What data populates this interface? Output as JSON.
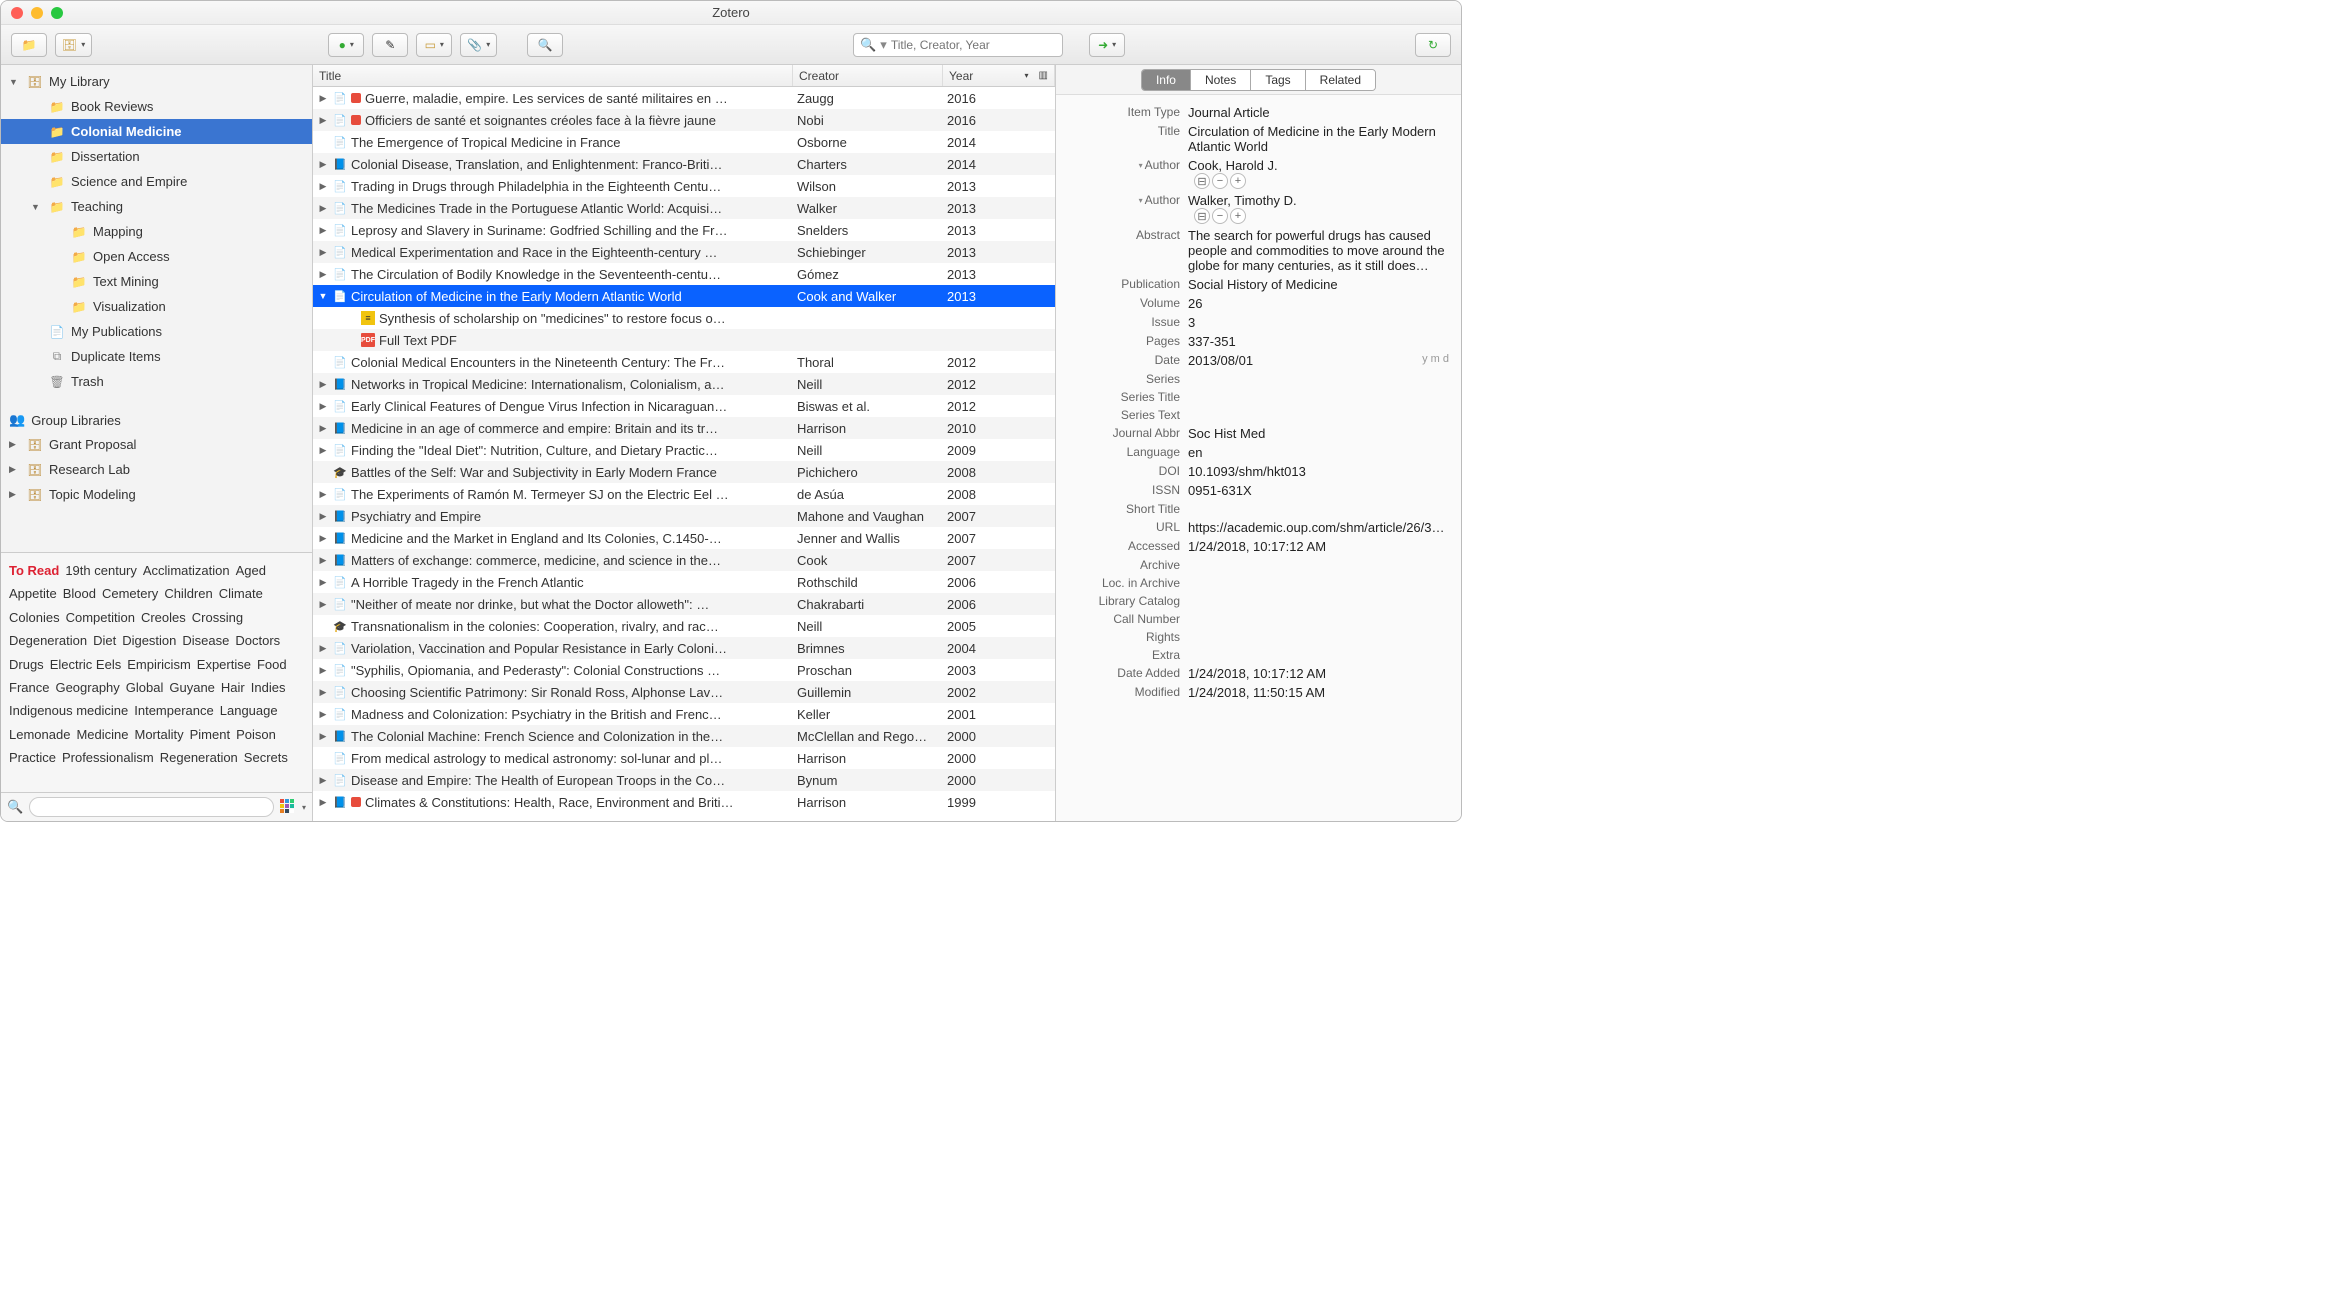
{
  "window_title": "Zotero",
  "toolbar": {
    "search_placeholder": "Title, Creator, Year"
  },
  "sidebar": {
    "my_library": "My Library",
    "items": [
      {
        "label": "Book Reviews",
        "depth": 1
      },
      {
        "label": "Colonial Medicine",
        "depth": 1,
        "selected": true
      },
      {
        "label": "Dissertation",
        "depth": 1
      },
      {
        "label": "Science and Empire",
        "depth": 1
      },
      {
        "label": "Teaching",
        "depth": 1,
        "expandable": true,
        "expanded": true
      },
      {
        "label": "Mapping",
        "depth": 2
      },
      {
        "label": "Open Access",
        "depth": 2
      },
      {
        "label": "Text Mining",
        "depth": 2
      },
      {
        "label": "Visualization",
        "depth": 2
      }
    ],
    "special": [
      {
        "label": "My Publications",
        "icon": "pubs"
      },
      {
        "label": "Duplicate Items",
        "icon": "dup"
      },
      {
        "label": "Trash",
        "icon": "trash"
      }
    ],
    "group_header": "Group Libraries",
    "groups": [
      {
        "label": "Grant Proposal"
      },
      {
        "label": "Research Lab"
      },
      {
        "label": "Topic Modeling"
      }
    ]
  },
  "tags": [
    "To Read",
    "19th century",
    "Acclimatization",
    "Aged",
    "Appetite",
    "Blood",
    "Cemetery",
    "Children",
    "Climate",
    "Colonies",
    "Competition",
    "Creoles",
    "Crossing",
    "Degeneration",
    "Diet",
    "Digestion",
    "Disease",
    "Doctors",
    "Drugs",
    "Electric Eels",
    "Empiricism",
    "Expertise",
    "Food",
    "France",
    "Geography",
    "Global",
    "Guyane",
    "Hair",
    "Indies",
    "Indigenous medicine",
    "Intemperance",
    "Language",
    "Lemonade",
    "Medicine",
    "Mortality",
    "Piment",
    "Poison",
    "Practice",
    "Professionalism",
    "Regeneration",
    "Secrets"
  ],
  "tag_hot": "To Read",
  "columns": {
    "title": "Title",
    "creator": "Creator",
    "year": "Year"
  },
  "items": [
    {
      "tw": "▶",
      "type": "page",
      "tag": "red",
      "title": "Guerre, maladie, empire. Les services de santé militaires en …",
      "creator": "Zaugg",
      "year": "2016"
    },
    {
      "tw": "▶",
      "type": "page",
      "tag": "red",
      "title": "Officiers de santé et soignantes créoles face à la fièvre jaune",
      "creator": "Nobi",
      "year": "2016"
    },
    {
      "tw": "",
      "type": "page",
      "title": "The Emergence of Tropical Medicine in France",
      "creator": "Osborne",
      "year": "2014"
    },
    {
      "tw": "▶",
      "type": "book",
      "title": "Colonial Disease, Translation, and Enlightenment: Franco-Briti…",
      "creator": "Charters",
      "year": "2014"
    },
    {
      "tw": "▶",
      "type": "page",
      "title": "Trading in Drugs through Philadelphia in the Eighteenth Centu…",
      "creator": "Wilson",
      "year": "2013"
    },
    {
      "tw": "▶",
      "type": "page",
      "title": "The Medicines Trade in the Portuguese Atlantic World: Acquisi…",
      "creator": "Walker",
      "year": "2013"
    },
    {
      "tw": "▶",
      "type": "page",
      "title": "Leprosy and Slavery in Suriname: Godfried Schilling and the Fr…",
      "creator": "Snelders",
      "year": "2013"
    },
    {
      "tw": "▶",
      "type": "page",
      "title": "Medical Experimentation and Race in the Eighteenth-century …",
      "creator": "Schiebinger",
      "year": "2013"
    },
    {
      "tw": "▶",
      "type": "page",
      "title": "The Circulation of Bodily Knowledge in the Seventeenth-centu…",
      "creator": "Gómez",
      "year": "2013"
    },
    {
      "tw": "▼",
      "type": "page",
      "title": "Circulation of Medicine in the Early Modern Atlantic World",
      "creator": "Cook and Walker",
      "year": "2013",
      "selected": true
    },
    {
      "tw": "",
      "type": "child-note",
      "title": "Synthesis of scholarship on \"medicines\" to restore focus o…",
      "creator": "",
      "year": ""
    },
    {
      "tw": "",
      "type": "child-pdf",
      "title": "Full Text PDF",
      "creator": "",
      "year": ""
    },
    {
      "tw": "",
      "type": "page",
      "title": "Colonial Medical Encounters in the Nineteenth Century: The Fr…",
      "creator": "Thoral",
      "year": "2012"
    },
    {
      "tw": "▶",
      "type": "book",
      "title": "Networks in Tropical Medicine: Internationalism, Colonialism, a…",
      "creator": "Neill",
      "year": "2012"
    },
    {
      "tw": "▶",
      "type": "page",
      "title": "Early Clinical Features of Dengue Virus Infection in Nicaraguan…",
      "creator": "Biswas et al.",
      "year": "2012"
    },
    {
      "tw": "▶",
      "type": "book",
      "title": "Medicine in an age of commerce and empire: Britain and its tr…",
      "creator": "Harrison",
      "year": "2010"
    },
    {
      "tw": "▶",
      "type": "page",
      "title": "Finding the \"Ideal Diet\": Nutrition, Culture, and Dietary Practic…",
      "creator": "Neill",
      "year": "2009"
    },
    {
      "tw": "",
      "type": "thesis",
      "title": "Battles of the Self: War and Subjectivity in Early Modern France",
      "creator": "Pichichero",
      "year": "2008"
    },
    {
      "tw": "▶",
      "type": "page",
      "title": "The Experiments of Ramón M. Termeyer SJ on the Electric Eel …",
      "creator": "de Asúa",
      "year": "2008"
    },
    {
      "tw": "▶",
      "type": "book",
      "title": "Psychiatry and Empire",
      "creator": "Mahone and Vaughan",
      "year": "2007"
    },
    {
      "tw": "▶",
      "type": "book",
      "title": "Medicine and the Market in England and Its Colonies, C.1450-…",
      "creator": "Jenner and Wallis",
      "year": "2007"
    },
    {
      "tw": "▶",
      "type": "book",
      "title": "Matters of exchange: commerce, medicine, and science in the…",
      "creator": "Cook",
      "year": "2007"
    },
    {
      "tw": "▶",
      "type": "page",
      "title": "A Horrible Tragedy in the French Atlantic",
      "creator": "Rothschild",
      "year": "2006"
    },
    {
      "tw": "▶",
      "type": "page",
      "title": "\"Neither of meate nor drinke, but what the Doctor alloweth\": …",
      "creator": "Chakrabarti",
      "year": "2006"
    },
    {
      "tw": "",
      "type": "thesis",
      "title": "Transnationalism in the colonies: Cooperation, rivalry, and rac…",
      "creator": "Neill",
      "year": "2005"
    },
    {
      "tw": "▶",
      "type": "page",
      "title": "Variolation, Vaccination and Popular Resistance in Early Coloni…",
      "creator": "Brimnes",
      "year": "2004"
    },
    {
      "tw": "▶",
      "type": "page",
      "title": "\"Syphilis, Opiomania, and Pederasty\": Colonial Constructions …",
      "creator": "Proschan",
      "year": "2003"
    },
    {
      "tw": "▶",
      "type": "page",
      "title": "Choosing Scientific Patrimony: Sir Ronald Ross, Alphonse Lav…",
      "creator": "Guillemin",
      "year": "2002"
    },
    {
      "tw": "▶",
      "type": "page",
      "title": "Madness and Colonization: Psychiatry in the British and Frenc…",
      "creator": "Keller",
      "year": "2001"
    },
    {
      "tw": "▶",
      "type": "book",
      "title": "The Colonial Machine: French Science and Colonization in the…",
      "creator": "McClellan and Rego…",
      "year": "2000"
    },
    {
      "tw": "",
      "type": "page",
      "title": "From medical astrology to medical astronomy: sol-lunar and pl…",
      "creator": "Harrison",
      "year": "2000"
    },
    {
      "tw": "▶",
      "type": "page",
      "title": "Disease and Empire: The Health of European Troops in the Co…",
      "creator": "Bynum",
      "year": "2000"
    },
    {
      "tw": "▶",
      "type": "book",
      "tag": "red",
      "title": "Climates & Constitutions: Health, Race, Environment and Briti…",
      "creator": "Harrison",
      "year": "1999"
    }
  ],
  "info_tabs": [
    "Info",
    "Notes",
    "Tags",
    "Related"
  ],
  "info_active": "Info",
  "meta": {
    "item_type_label": "Item Type",
    "item_type": "Journal Article",
    "title_label": "Title",
    "title": "Circulation of Medicine in the Early Modern Atlantic World",
    "author_label": "Author",
    "author1": "Cook, Harold J.",
    "author2": "Walker, Timothy D.",
    "abstract_label": "Abstract",
    "abstract": "The search for powerful drugs has caused people and commodities to move around the globe for many centuries, as it still does…",
    "publication_label": "Publication",
    "publication": "Social History of Medicine",
    "volume_label": "Volume",
    "volume": "26",
    "issue_label": "Issue",
    "issue": "3",
    "pages_label": "Pages",
    "pages": "337-351",
    "date_label": "Date",
    "date": "2013/08/01",
    "date_hint": "y m d",
    "series_label": "Series",
    "series": "",
    "series_title_label": "Series Title",
    "series_title": "",
    "series_text_label": "Series Text",
    "series_text": "",
    "journal_abbr_label": "Journal Abbr",
    "journal_abbr": "Soc Hist Med",
    "language_label": "Language",
    "language": "en",
    "doi_label": "DOI",
    "doi": "10.1093/shm/hkt013",
    "issn_label": "ISSN",
    "issn": "0951-631X",
    "short_title_label": "Short Title",
    "short_title": "",
    "url_label": "URL",
    "url": "https://academic.oup.com/shm/article/26/3…",
    "accessed_label": "Accessed",
    "accessed": "1/24/2018, 10:17:12 AM",
    "archive_label": "Archive",
    "archive": "",
    "loc_label": "Loc. in Archive",
    "loc": "",
    "catalog_label": "Library Catalog",
    "catalog": "",
    "call_label": "Call Number",
    "call": "",
    "rights_label": "Rights",
    "rights": "",
    "extra_label": "Extra",
    "extra": "",
    "added_label": "Date Added",
    "added": "1/24/2018, 10:17:12 AM",
    "modified_label": "Modified",
    "modified": "1/24/2018, 11:50:15 AM"
  }
}
